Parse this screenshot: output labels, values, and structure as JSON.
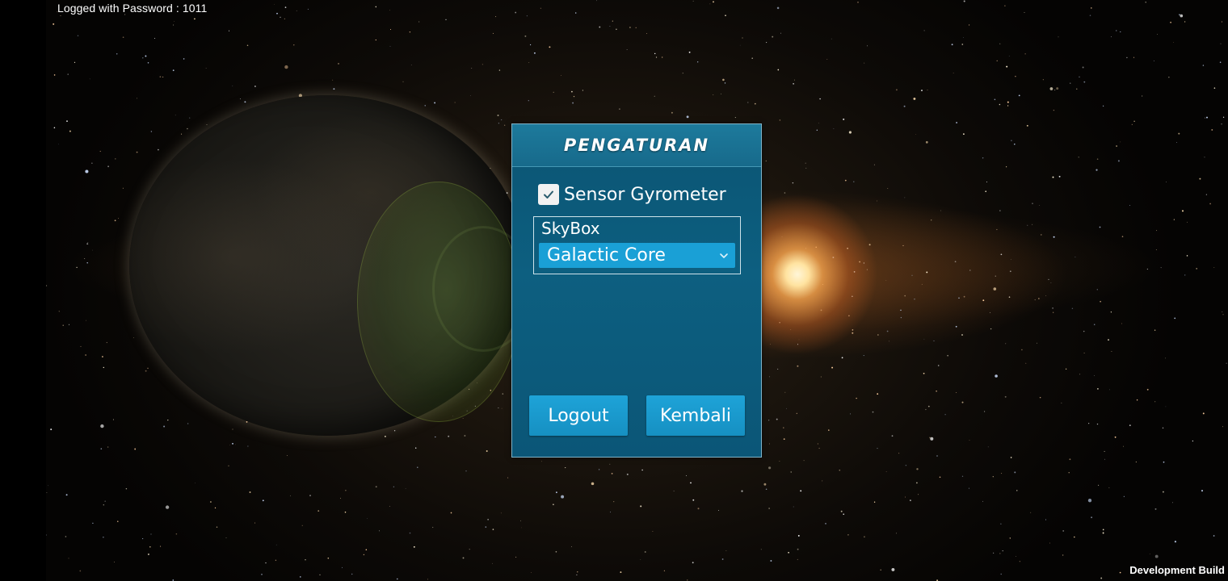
{
  "hud": {
    "login_status": "Logged with Password : 1011",
    "build_label": "Development Build"
  },
  "settings_panel": {
    "title": "PENGATURAN",
    "gyrometer": {
      "label": "Sensor Gyrometer",
      "checked": true
    },
    "skybox": {
      "label": "SkyBox",
      "selected": "Galactic Core"
    },
    "buttons": {
      "logout": "Logout",
      "back": "Kembali"
    }
  },
  "colors": {
    "panel": "#0d5f80",
    "button": "#1aa0d6"
  },
  "icons": {
    "checkbox": "checkmark-icon",
    "dropdown": "chevron-down-icon"
  }
}
